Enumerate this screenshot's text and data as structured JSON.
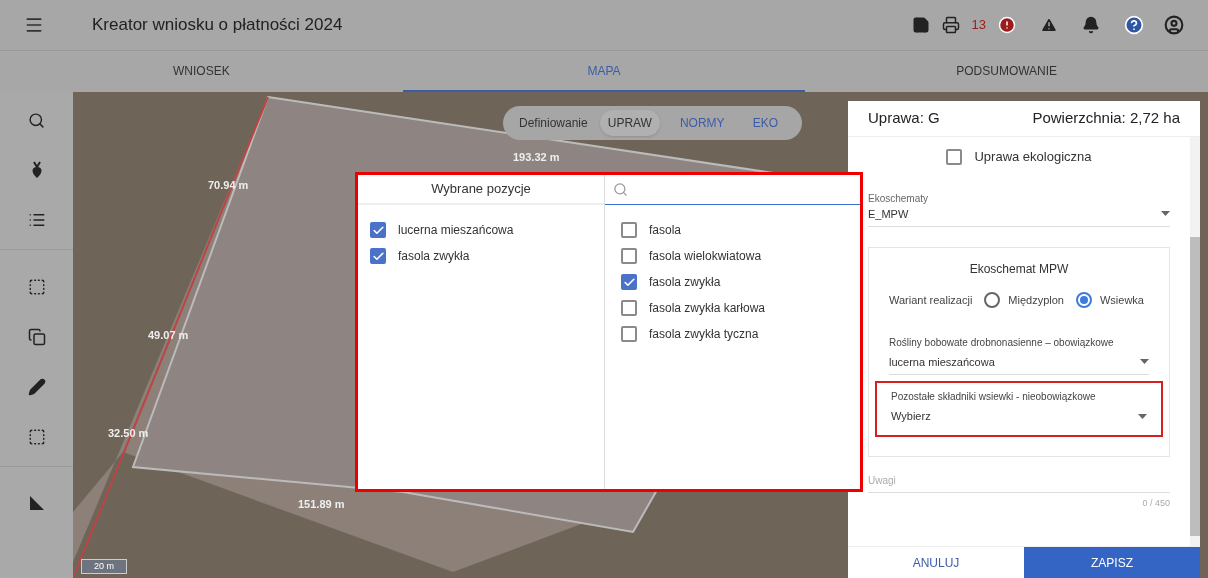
{
  "app_bar": {
    "title": "Kreator wniosku o płatności 2024",
    "error_count": "13"
  },
  "tabs": [
    {
      "label": "WNIOSEK",
      "selected": false
    },
    {
      "label": "MAPA",
      "selected": true
    },
    {
      "label": "PODSUMOWANIE",
      "selected": false
    }
  ],
  "map": {
    "mode_label": "Definiowanie",
    "modes": [
      {
        "label": "UPRAW",
        "selected": true
      },
      {
        "label": "NORMY",
        "selected": false
      },
      {
        "label": "EKO",
        "selected": false
      }
    ],
    "measurements": [
      "193.32 m",
      "70.94 m",
      "49.07 m",
      "32.50 m",
      "151.89 m"
    ],
    "scale": "20 m"
  },
  "picker": {
    "selected_title": "Wybrane pozycje",
    "selected_items": [
      {
        "label": "lucerna mieszańcowa",
        "checked": true
      },
      {
        "label": "fasola zwykła",
        "checked": true
      }
    ],
    "options": [
      {
        "label": "fasola",
        "checked": false
      },
      {
        "label": "fasola wielokwiatowa",
        "checked": false
      },
      {
        "label": "fasola zwykła",
        "checked": true
      },
      {
        "label": "fasola zwykła karłowa",
        "checked": false
      },
      {
        "label": "fasola zwykła tyczna",
        "checked": false
      }
    ]
  },
  "panel": {
    "crop": "Uprawa: G",
    "area": "Powierzchnia: 2,72 ha",
    "organic": {
      "label": "Uprawa ekologiczna",
      "checked": false
    },
    "ecoschemes": {
      "label": "Ekoschematy",
      "value": "E_MPW"
    },
    "section": {
      "title": "Ekoschemat MPW",
      "variant_label": "Wariant realizacji",
      "variants": [
        {
          "label": "Międzyplon",
          "selected": false
        },
        {
          "label": "Wsiewka",
          "selected": true
        }
      ],
      "fields": [
        {
          "label": "Rośliny bobowate drobnonasienne – obowiązkowe",
          "value": "lucerna mieszańcowa",
          "highlighted": false
        },
        {
          "label": "Pozostałe składniki wsiewki - nieobowiązkowe",
          "value": "Wybierz",
          "highlighted": true
        }
      ]
    },
    "notes": {
      "placeholder": "Uwagi",
      "counter": "0 / 450"
    },
    "buttons": [
      {
        "label": "ANULUJ",
        "kind": "text"
      },
      {
        "label": "ZAPISZ",
        "kind": "primary"
      }
    ]
  }
}
